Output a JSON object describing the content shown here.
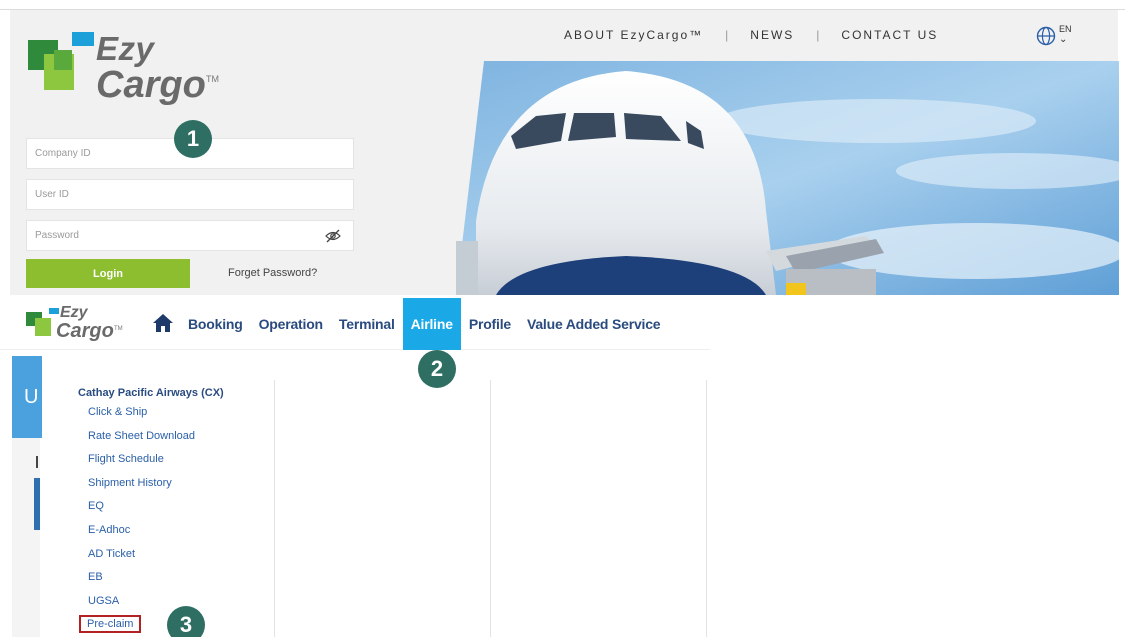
{
  "top_nav": {
    "about": "ABOUT EzyCargo™",
    "news": "NEWS",
    "contact": "CONTACT US",
    "separator": "|",
    "lang": "EN"
  },
  "logo": {
    "line1": "Ezy",
    "line2": "Cargo",
    "tm": "TM"
  },
  "login": {
    "company_placeholder": "Company ID",
    "user_placeholder": "User ID",
    "password_placeholder": "Password",
    "login_label": "Login",
    "forget_label": "Forget Password?"
  },
  "steps": [
    "1",
    "2",
    "3"
  ],
  "main_nav": {
    "logo_line1": "Ezy",
    "logo_line2": "Cargo",
    "logo_tm": "TM",
    "items": [
      "Booking",
      "Operation",
      "Terminal",
      "Airline",
      "Profile",
      "Value Added Service"
    ],
    "active": "Airline"
  },
  "background": {
    "letter": "U"
  },
  "dropdown": {
    "heading": "Cathay Pacific Airways (CX)",
    "items": [
      "Click & Ship",
      "Rate Sheet Download",
      "Flight Schedule",
      "Shipment History",
      "EQ",
      "E-Adhoc",
      "AD Ticket",
      "EB",
      "UGSA",
      "Pre-claim"
    ],
    "highlighted": "Pre-claim"
  },
  "colors": {
    "brand_green": "#8dbe2f",
    "brand_dark_green": "#2f8a3c",
    "brand_blue": "#1ba8e6",
    "nav_text": "#2a4b80",
    "step_circle": "#2e6e63",
    "highlight_border": "#b22222"
  }
}
